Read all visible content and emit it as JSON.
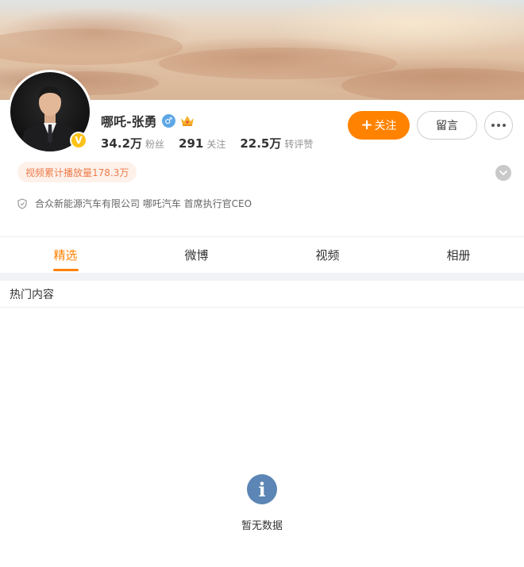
{
  "profile": {
    "name": "哪吒-张勇",
    "verified_badge": "V",
    "gender_icon": "male-icon",
    "gender_symbol": "♂",
    "stats": [
      {
        "value": "34.2万",
        "label": "粉丝"
      },
      {
        "value": "291",
        "label": "关注"
      },
      {
        "value": "22.5万",
        "label": "转评赞"
      }
    ],
    "video_plays": "视频累计播放量178.3万",
    "company": "合众新能源汽车有限公司 哪吒汽车 首席执行官CEO"
  },
  "actions": {
    "follow_plus": "+",
    "follow_label": "关注",
    "message_label": "留言"
  },
  "tabs": [
    {
      "label": "精选",
      "active": true
    },
    {
      "label": "微博",
      "active": false
    },
    {
      "label": "视频",
      "active": false
    },
    {
      "label": "相册",
      "active": false
    }
  ],
  "section": {
    "title": "热门内容"
  },
  "empty_state": {
    "icon": "info-icon",
    "icon_glyph": "i",
    "text": "暂无数据"
  },
  "colors": {
    "accent": "#ff8200",
    "tag_text": "#ef7b49",
    "tag_bg": "#fdf1ea",
    "info_icon": "#5b86b5",
    "verified": "#ffc21a"
  }
}
